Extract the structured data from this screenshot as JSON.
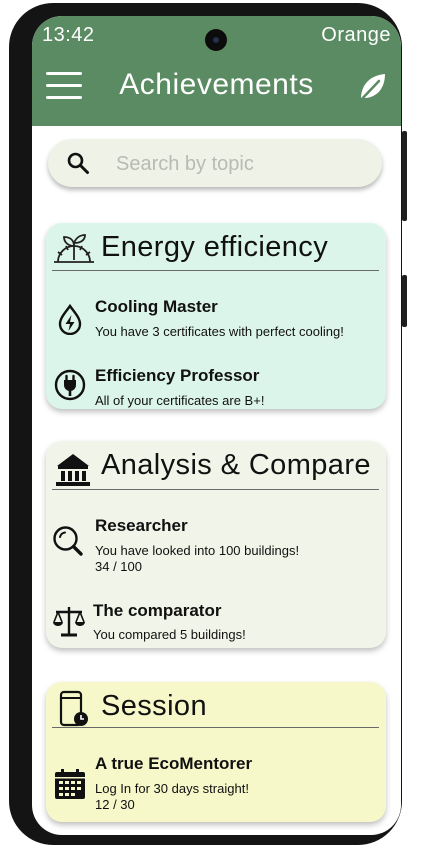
{
  "status_bar": {
    "time": "13:42",
    "carrier": "Orange"
  },
  "app_bar": {
    "title": "Achievements",
    "menu_icon": "hamburger-menu-icon",
    "action_icon": "leaf-icon"
  },
  "search": {
    "placeholder": "Search by topic",
    "value": ""
  },
  "colors": {
    "app_bar": "#5b8b62",
    "energy_card": "#dcf5ea",
    "analysis_card": "#f1f4e8",
    "session_card": "#f6f8c9"
  },
  "sections": [
    {
      "title": "Energy efficiency",
      "icon": "plant-gear-icon",
      "items": [
        {
          "title": "Cooling Master",
          "description": "You have 3 certificates with perfect cooling!",
          "icon": "energy-drop-icon"
        },
        {
          "title": "Efficiency Professor",
          "description": "All of your certificates are B+!",
          "icon": "power-plug-icon"
        }
      ]
    },
    {
      "title": "Analysis & Compare",
      "icon": "building-icon",
      "items": [
        {
          "title": "Researcher",
          "description": "You have looked into 100 buildings!",
          "progress": "34 / 100",
          "icon": "magnifier-icon"
        },
        {
          "title": "The comparator",
          "description": "You compared 5 buildings!",
          "icon": "scales-icon"
        }
      ]
    },
    {
      "title": "Session",
      "icon": "phone-clock-icon",
      "items": [
        {
          "title": "A true EcoMentorer",
          "description": "Log In for 30 days straight!",
          "progress": "12 / 30",
          "icon": "calendar-icon"
        }
      ]
    }
  ]
}
